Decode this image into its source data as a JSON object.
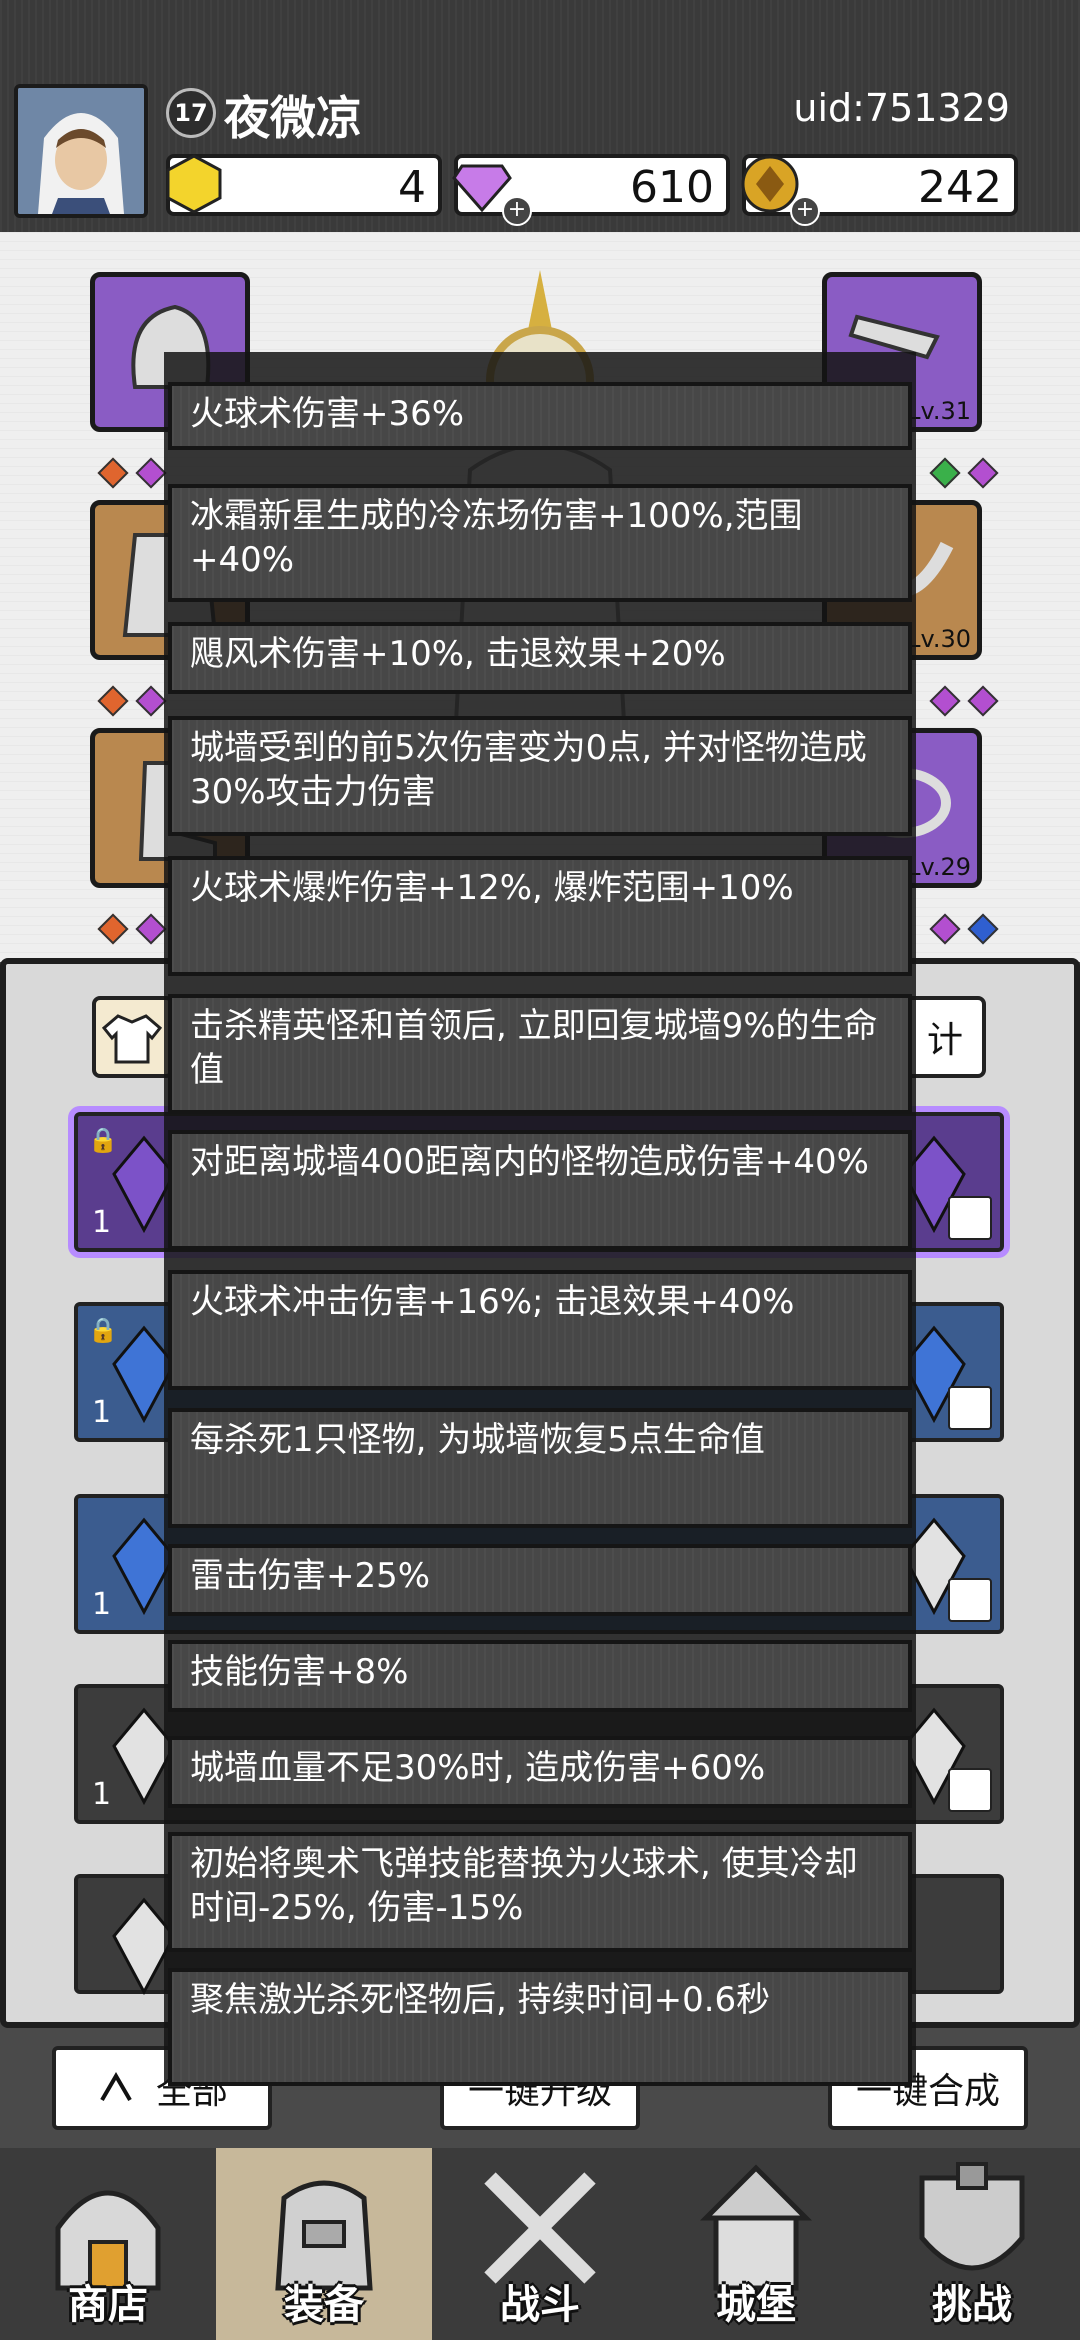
{
  "player": {
    "level": "17",
    "name": "夜微凉",
    "uid": "uid:751329"
  },
  "currency": {
    "gold_gems": "4",
    "diamonds": "610",
    "coins": "242"
  },
  "equipment": {
    "right_levels": [
      "Lv.31",
      "Lv.30",
      "Lv.29"
    ]
  },
  "inventory": {
    "stats_label": "计",
    "row_counts": [
      "1",
      "1",
      "1",
      "1"
    ],
    "buttons": {
      "all": "全部",
      "upgrade": "一键升级",
      "merge": "一键合成"
    }
  },
  "effects": [
    "火球术伤害+36%",
    "冰霜新星生成的冷冻场伤害+100%,范围+40%",
    "飓风术伤害+10%, 击退效果+20%",
    "城墙受到的前5次伤害变为0点, 并对怪物造成30%攻击力伤害",
    "火球术爆炸伤害+12%, 爆炸范围+10%",
    "击杀精英怪和首领后, 立即回复城墙9%的生命值",
    "对距离城墙400距离内的怪物造成伤害+40%",
    "火球术冲击伤害+16%; 击退效果+40%",
    "每杀死1只怪物, 为城墙恢复5点生命值",
    "雷击伤害+25%",
    "技能伤害+8%",
    "城墙血量不足30%时, 造成伤害+60%",
    "初始将奥术飞弹技能替换为火球术, 使其冷却时间-25%, 伤害-15%",
    "聚焦激光杀死怪物后, 持续时间+0.6秒"
  ],
  "nav": [
    {
      "label": "商店"
    },
    {
      "label": "装备"
    },
    {
      "label": "战斗"
    },
    {
      "label": "城堡"
    },
    {
      "label": "挑战"
    }
  ],
  "colors": {
    "epic": "#8a5cc4",
    "rare": "#3b5c8f",
    "legendary": "#b9884f",
    "panel": "#474747"
  }
}
